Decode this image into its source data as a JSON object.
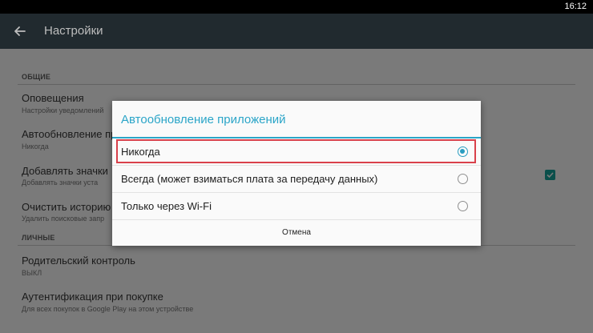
{
  "status_bar": {
    "time": "16:12"
  },
  "app_bar": {
    "title": "Настройки"
  },
  "sections": {
    "general": "ОБЩИЕ",
    "personal": "ЛИЧНЫЕ"
  },
  "prefs": {
    "notifications": {
      "title": "Оповещения",
      "subtitle": "Настройки уведомлений"
    },
    "auto_update": {
      "title": "Автообновление пр",
      "subtitle": "Никогда"
    },
    "add_icons": {
      "title": "Добавлять значки",
      "subtitle": "Добавлять значки уста"
    },
    "clear_history": {
      "title": "Очистить историю",
      "subtitle": "Удалить поисковые запр"
    },
    "parental": {
      "title": "Родительский контроль",
      "subtitle": "ВЫКЛ"
    },
    "auth": {
      "title": "Аутентификация при покупке",
      "subtitle": "Для всех покупок в Google Play на этом устройстве"
    }
  },
  "dialog": {
    "title": "Автообновление приложений",
    "options": [
      {
        "label": "Никогда",
        "selected": true
      },
      {
        "label": "Всегда (может взиматься плата за передачу данных)",
        "selected": false
      },
      {
        "label": "Только через Wi-Fi",
        "selected": false
      }
    ],
    "cancel_label": "Отмена"
  },
  "colors": {
    "accent": "#2ba5c8",
    "highlight": "#d9414b",
    "appbar": "#212a2f"
  },
  "icons": {
    "back": "arrow-left-icon",
    "checkbox": "check-icon"
  }
}
